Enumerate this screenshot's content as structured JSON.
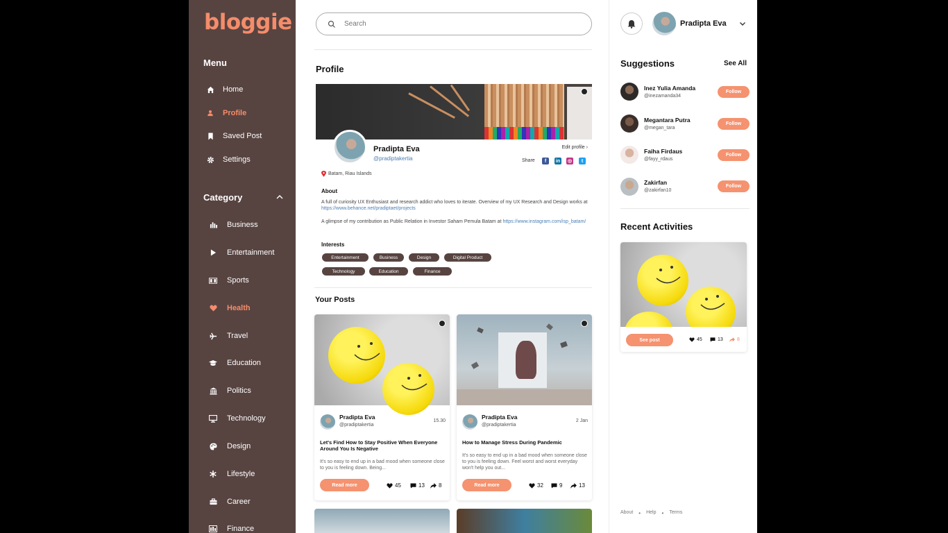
{
  "app": {
    "logo": "bloggie"
  },
  "sidebar": {
    "menu_title": "Menu",
    "menu": [
      {
        "label": "Home",
        "icon": "home-icon"
      },
      {
        "label": "Profile",
        "icon": "user-icon",
        "active": true
      },
      {
        "label": "Saved Post",
        "icon": "bookmark-icon"
      },
      {
        "label": "Settings",
        "icon": "gear-icon"
      }
    ],
    "category_title": "Category",
    "categories": [
      {
        "label": "Business",
        "icon": "bar-chart-icon"
      },
      {
        "label": "Entertainment",
        "icon": "play-icon"
      },
      {
        "label": "Sports",
        "icon": "scoreboard-icon"
      },
      {
        "label": "Health",
        "icon": "heart-icon",
        "active": true
      },
      {
        "label": "Travel",
        "icon": "plane-icon"
      },
      {
        "label": "Education",
        "icon": "graduation-cap-icon"
      },
      {
        "label": "Politics",
        "icon": "government-icon"
      },
      {
        "label": "Technology",
        "icon": "monitor-icon"
      },
      {
        "label": "Design",
        "icon": "palette-icon"
      },
      {
        "label": "Lifestyle",
        "icon": "sparkle-icon"
      },
      {
        "label": "Career",
        "icon": "briefcase-icon"
      },
      {
        "label": "Finance",
        "icon": "finance-icon"
      }
    ]
  },
  "search": {
    "placeholder": "Search",
    "value": ""
  },
  "profile": {
    "heading": "Profile",
    "name": "Pradipta Eva",
    "handle": "@pradiptakertia",
    "edit_label": "Edit profile",
    "share_label": "Share",
    "location": "Batam, Riau Islands",
    "about_heading": "About",
    "about_text_1": "A full of curiosity UX Enthusiast and research addict who loves to iterate. Overview of my UX Research and Design works at ",
    "about_link_1": "https://www.behance.net/pradiptaet/projects",
    "about_text_2": "A glimpse of my contribution as Public Relation in Investor Saham Pemula Batam at ",
    "about_link_2": "https://www.instagram.com/isp_batam/",
    "interests_heading": "Interests",
    "interests": [
      "Entertainment",
      "Business",
      "Design",
      "Digital Product",
      "Technology",
      "Education",
      "Finance"
    ]
  },
  "posts": {
    "heading": "Your Posts",
    "items": [
      {
        "author": "Pradipta Eva",
        "handle": "@pradiptakertia",
        "time": "15.30",
        "title": "Let's Find How to Stay Positive When Everyone Around You Is Negative",
        "excerpt": "It's so easy to end up in a bad mood when someone close to you is feeling down. Being...",
        "read_label": "Read more",
        "likes": "45",
        "comments": "13",
        "shares": "8"
      },
      {
        "author": "Pradipta Eva",
        "handle": "@pradiptakertia",
        "time": "2 Jan",
        "title": "How to Manage Stress During Pandemic",
        "excerpt": "It's so easy to end up in a bad mood when someone close to you is feeling down. Feel worst and worst everyday won't help you out...",
        "read_label": "Read more",
        "likes": "32",
        "comments": "9",
        "shares": "13"
      }
    ]
  },
  "user": {
    "name": "Pradipta Eva"
  },
  "suggestions": {
    "heading": "Suggestions",
    "see_all": "See All",
    "follow_label": "Follow",
    "items": [
      {
        "name": "Inez Yulia Amanda",
        "handle": "@inezamanda34"
      },
      {
        "name": "Megantara Putra",
        "handle": "@megan_tara"
      },
      {
        "name": "Faiha Firdaus",
        "handle": "@fayy_rdaus"
      },
      {
        "name": "Zakirfan",
        "handle": "@zakirfan10"
      }
    ]
  },
  "recent": {
    "heading": "Recent Activities",
    "see_post": "See post",
    "likes": "45",
    "comments": "13",
    "shares": "8"
  },
  "footer": {
    "links": [
      "About",
      "Help",
      "Terms"
    ]
  },
  "colors": {
    "accent": "#f58c6a",
    "sidebar": "#574441",
    "link": "#4a7fb5"
  }
}
